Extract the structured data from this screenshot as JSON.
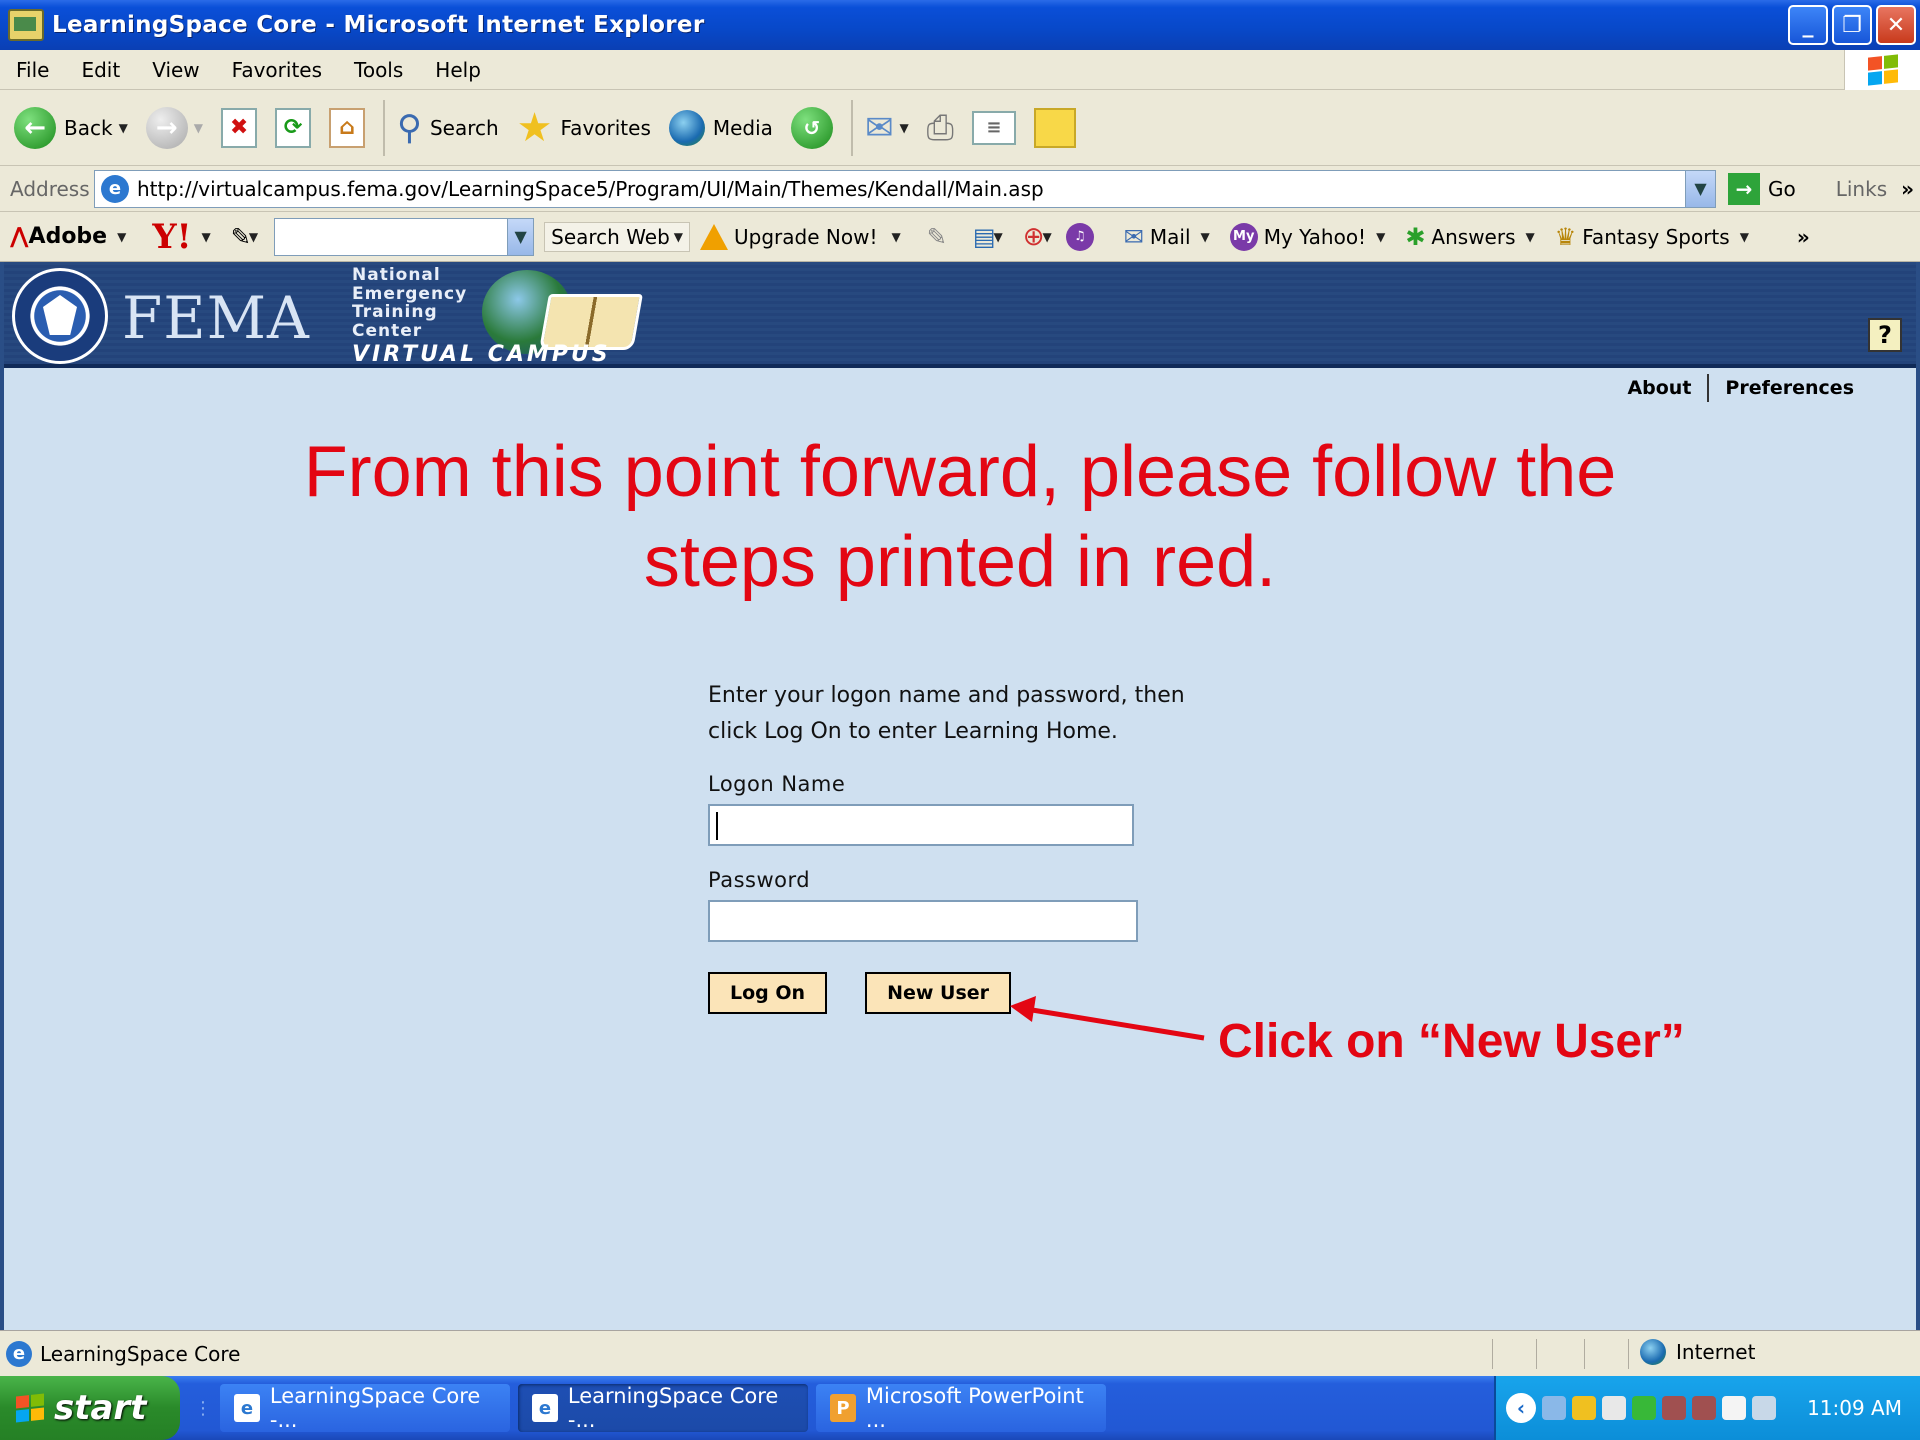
{
  "window": {
    "title": "LearningSpace Core - Microsoft Internet Explorer",
    "min": "_",
    "max": "❐",
    "close": "✕"
  },
  "menu": [
    "File",
    "Edit",
    "View",
    "Favorites",
    "Tools",
    "Help"
  ],
  "toolbar": {
    "back": "Back",
    "search": "Search",
    "favorites": "Favorites",
    "media": "Media"
  },
  "address": {
    "label": "Address",
    "url": "http://virtualcampus.fema.gov/LearningSpace5/Program/UI/Main/Themes/Kendall/Main.asp",
    "go": "Go",
    "links": "Links"
  },
  "yahoo_bar": {
    "adobe": "Adobe",
    "yahoo": "Y!",
    "search_web": "Search Web",
    "upgrade": "Upgrade Now!",
    "mail": "Mail",
    "my_yahoo": "My Yahoo!",
    "answers": "Answers",
    "fantasy": "Fantasy Sports"
  },
  "banner": {
    "agency": "FEMA",
    "netc_line1": "National",
    "netc_line2": "Emergency",
    "netc_line3": "Training",
    "netc_line4": "Center",
    "virtual_campus": "VIRTUAL CAMPUS",
    "help": "?"
  },
  "top_links": {
    "about": "About",
    "preferences": "Preferences"
  },
  "headline_line1": "From this point forward, please follow the",
  "headline_line2": "steps printed in red.",
  "form": {
    "instruction_line1": "Enter your logon name and password, then",
    "instruction_line2": "click Log On to enter Learning Home.",
    "logon_label": "Logon Name",
    "logon_value": "",
    "password_label": "Password",
    "password_value": "",
    "logon_button": "Log On",
    "new_user_button": "New User"
  },
  "callout": "Click on “New User”",
  "status": {
    "text": "LearningSpace Core",
    "zone": "Internet"
  },
  "taskbar": {
    "start": "start",
    "tasks": [
      "LearningSpace Core -...",
      "LearningSpace Core -...",
      "Microsoft PowerPoint ..."
    ],
    "clock": "11:09 AM"
  },
  "colors": {
    "annotation_red": "#e30613",
    "banner_blue": "#27497f",
    "content_bg": "#cfe0f0"
  }
}
